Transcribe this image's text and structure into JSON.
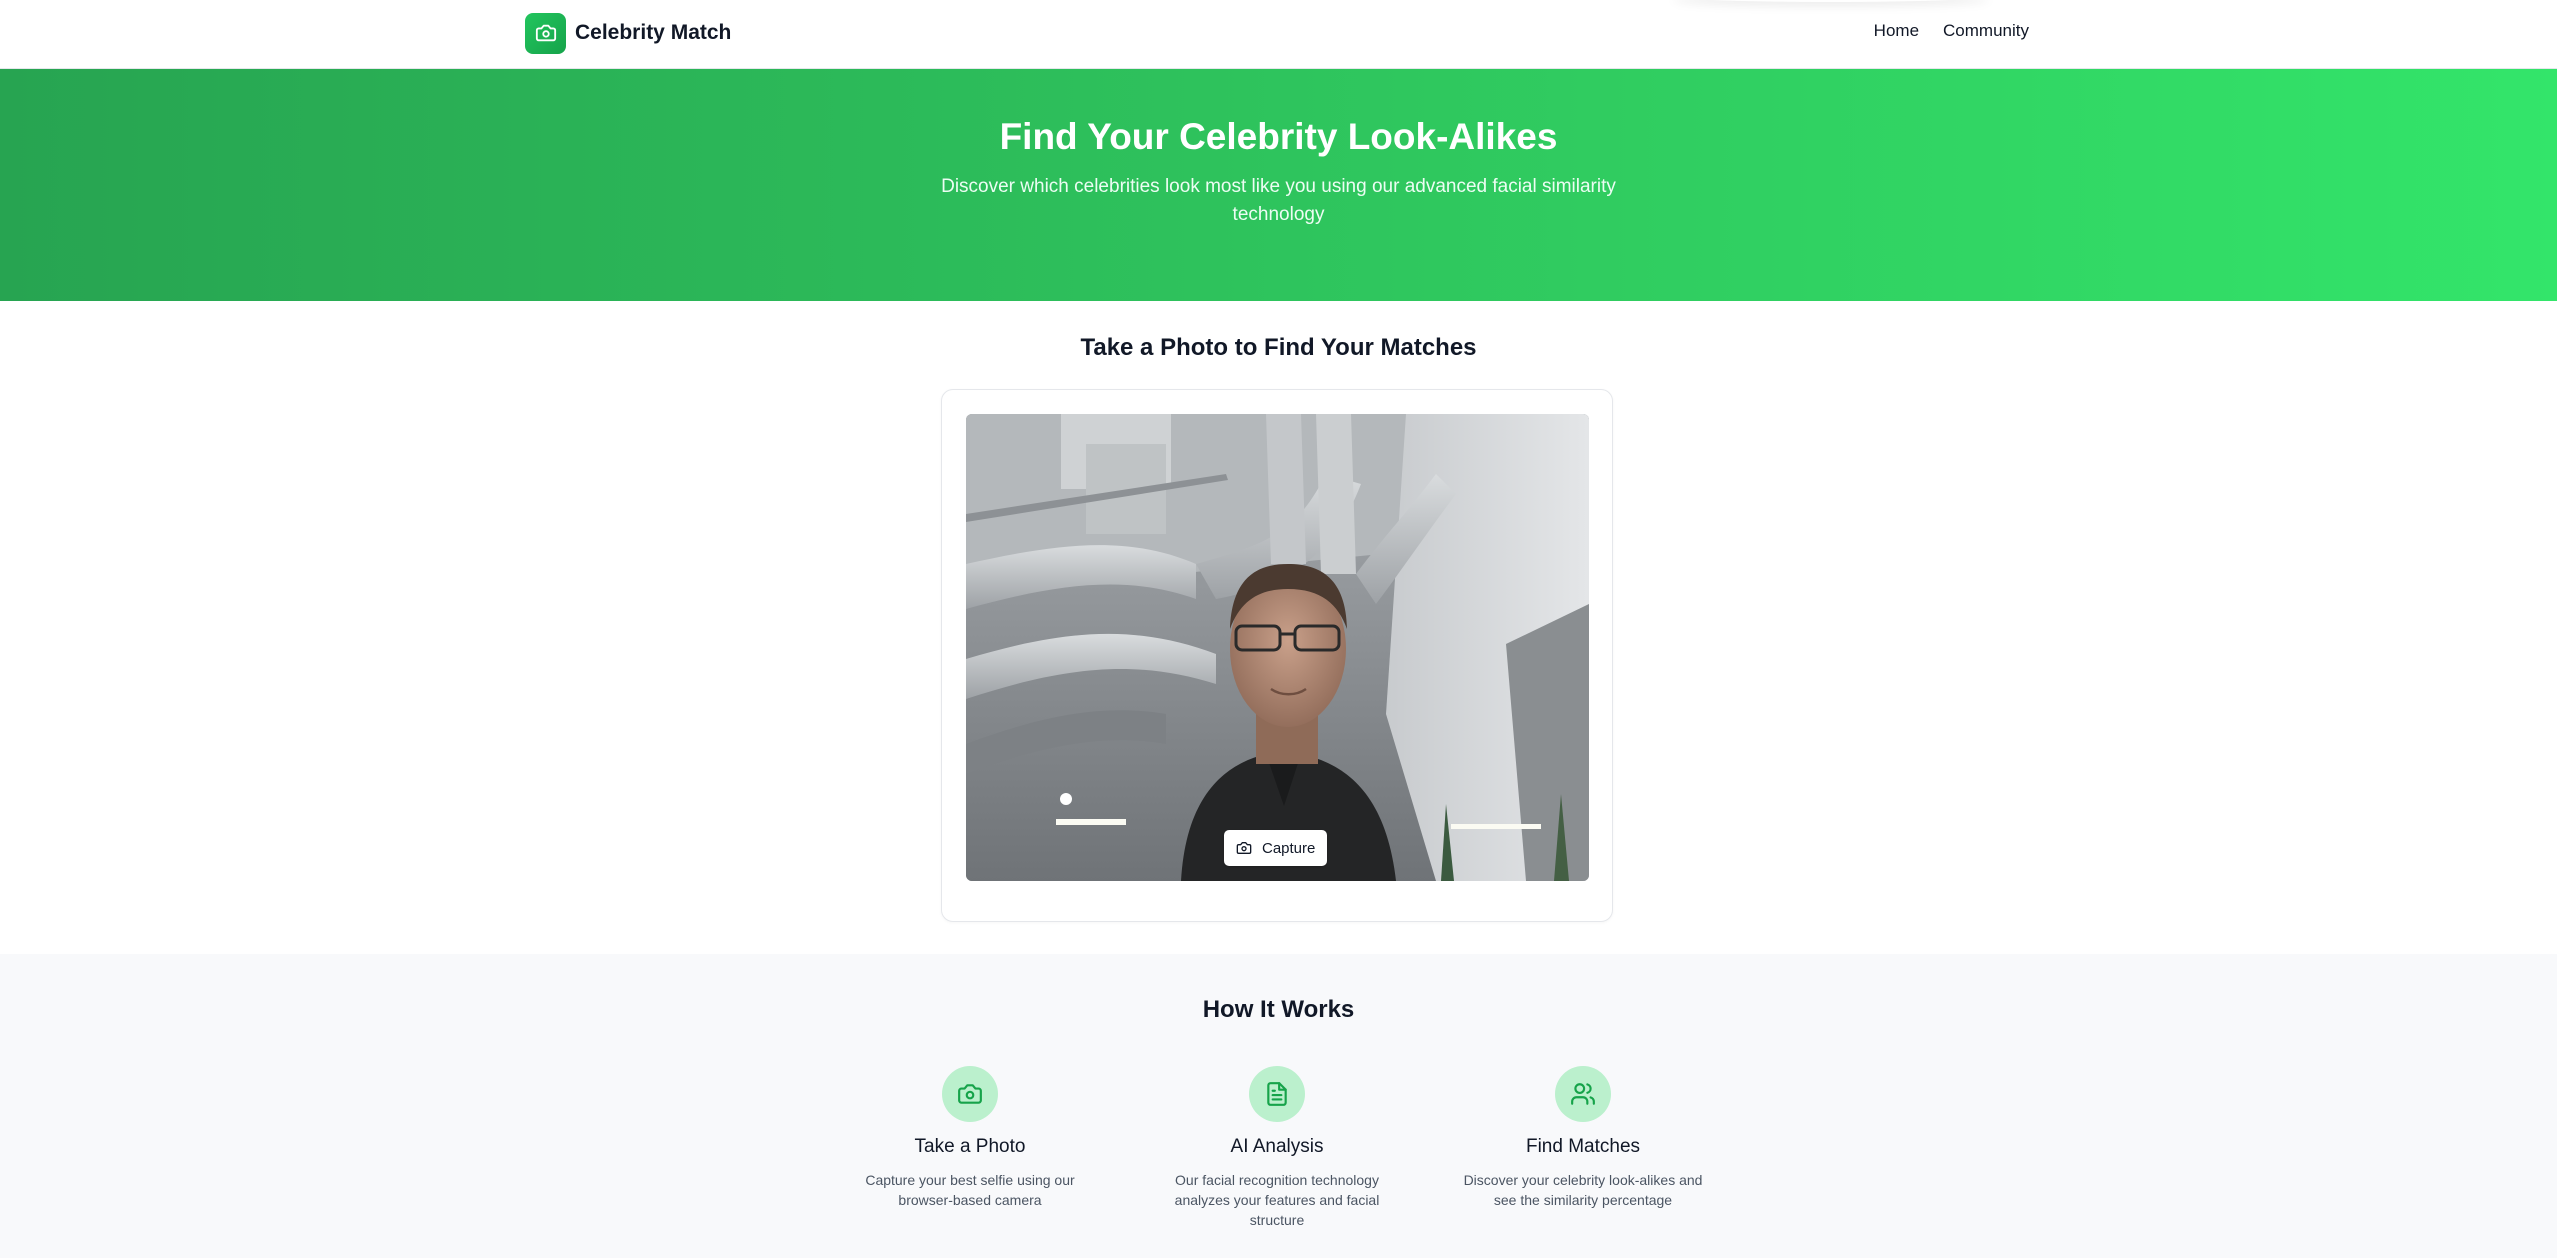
{
  "header": {
    "brand": "Celebrity Match",
    "brand_icon": "camera-icon",
    "nav": [
      {
        "label": "Home"
      },
      {
        "label": "Community"
      }
    ]
  },
  "hero": {
    "title": "Find Your Celebrity Look-Alikes",
    "subtitle": "Discover which celebrities look most like you using our advanced facial similarity technology"
  },
  "capture": {
    "title": "Take a Photo to Find Your Matches",
    "button_label": "Capture",
    "button_icon": "camera-icon"
  },
  "how_it_works": {
    "title": "How It Works",
    "steps": [
      {
        "icon": "camera-icon",
        "title": "Take a Photo",
        "description": "Capture your best selfie using our browser-based camera"
      },
      {
        "icon": "document-icon",
        "title": "AI Analysis",
        "description": "Our facial recognition technology analyzes your features and facial structure"
      },
      {
        "icon": "users-icon",
        "title": "Find Matches",
        "description": "Discover your celebrity look-alikes and see the similarity percentage"
      }
    ]
  },
  "colors": {
    "accent": "#22c55e",
    "hero_start": "#27a451",
    "hero_end": "#33e56a",
    "step_icon_bg": "#bbf0cd"
  }
}
